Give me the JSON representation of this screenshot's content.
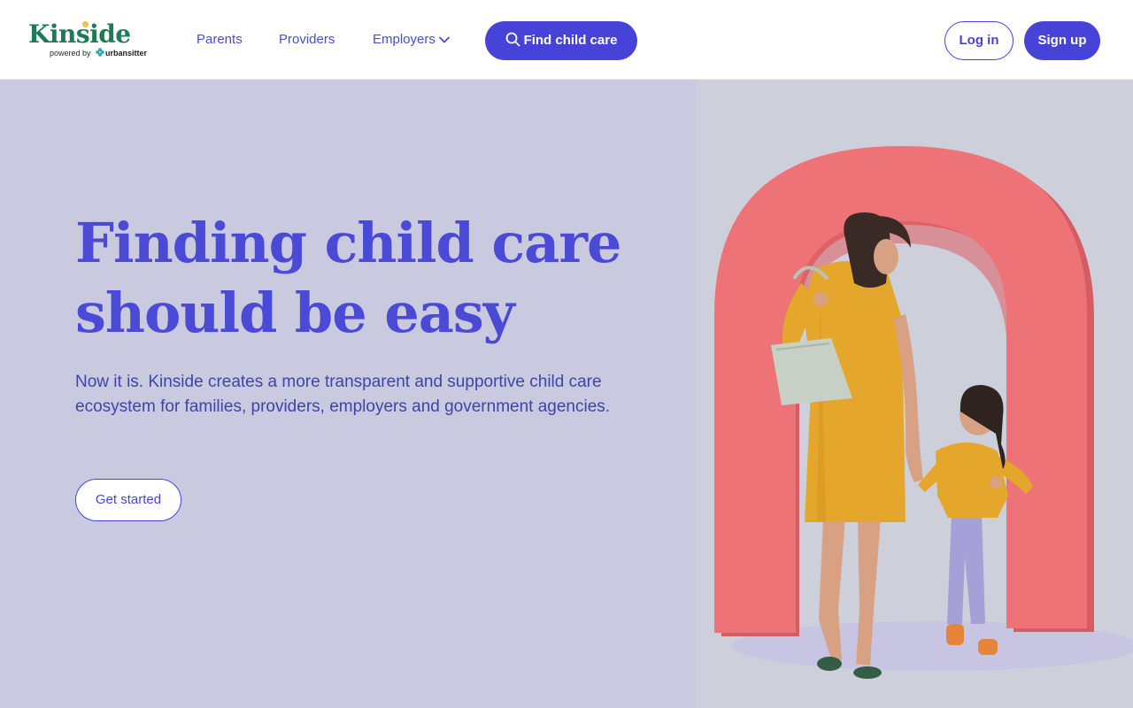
{
  "header": {
    "logo": {
      "name": "Kinside",
      "powered_by": "powered by",
      "partner": "urbansitter"
    },
    "nav": [
      {
        "label": "Parents"
      },
      {
        "label": "Providers"
      },
      {
        "label": "Employers"
      }
    ],
    "find_button": "Find child care",
    "login_button": "Log in",
    "signup_button": "Sign up"
  },
  "hero": {
    "title_line1": "Finding child care",
    "title_line2": "should be easy",
    "description": "Now it is. Kinside creates a more transparent and supportive child care ecosystem for families, providers, employers and government agencies.",
    "cta": "Get started"
  },
  "colors": {
    "brand_green": "#1f7a55",
    "accent_blue": "#4743d8",
    "hero_bg": "#c9cadf",
    "arch_coral": "#ee6f72",
    "dress_mustard": "#e5a72b"
  },
  "icons": {
    "search": "search-icon",
    "chevron": "chevron-down-icon"
  }
}
